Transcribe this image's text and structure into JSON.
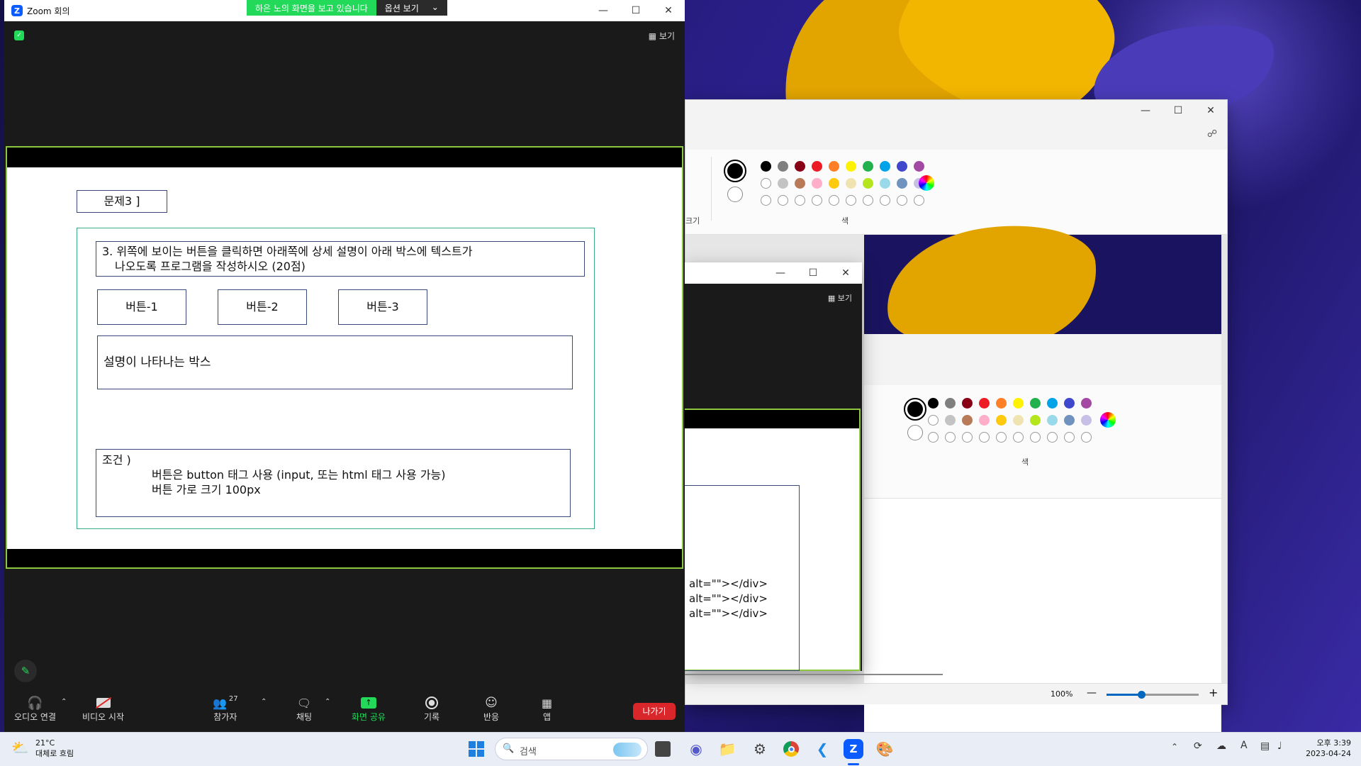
{
  "zoom": {
    "title": "Zoom 회의",
    "banner_text": "하은 노의 화면을 보고 있습니다",
    "options_label": "옵션 보기",
    "view_label": "보기",
    "leave_label": "나가기",
    "toolbar": {
      "audio": "오디오 연결",
      "video": "비디오 시작",
      "participants": "참가자",
      "participants_count": "27",
      "chat": "채팅",
      "share": "화면 공유",
      "record": "기록",
      "reactions": "반응",
      "apps": "앱"
    }
  },
  "slide": {
    "question_label": "문제3 ]",
    "question_line1": "3. 위쪽에 보이는 버튼을 클릭하면 아래쪽에 상세 설명이 아래 박스에 텍스트가",
    "question_line2": "나오도록 프로그램을 작성하시오 (20점)",
    "buttons": [
      "버튼-1",
      "버튼-2",
      "버튼-3"
    ],
    "desc_box": "설명이 나타나는 박스",
    "cond_title": "조건 )",
    "cond_line1": "버튼은 button 태그 사용 (input, 또는 html 태그 사용 가능)",
    "cond_line2": "버튼 가로 크기 100px"
  },
  "paint": {
    "color_section_label": "색",
    "size_label_fragment": "크기",
    "zoom_level": "100%",
    "colors_row1": [
      "#000000",
      "#7f7f7f",
      "#880015",
      "#ed1c24",
      "#ff7f27",
      "#fff200",
      "#22b14c",
      "#00a2e8",
      "#3f48cc",
      "#a349a4"
    ],
    "colors_row2": [
      "#ffffff",
      "#c3c3c3",
      "#b97a57",
      "#ffaec9",
      "#ffc90e",
      "#efe4b0",
      "#b5e61d",
      "#99d9ea",
      "#7092be",
      "#c8bfe7"
    ]
  },
  "mini_zoom": {
    "view_label": "보기",
    "code_lines": [
      "alt=\"\"></div>",
      "alt=\"\"></div>",
      "alt=\"\"></div>"
    ]
  },
  "taskbar": {
    "weather_temp": "21°C",
    "weather_desc": "대체로 흐림",
    "search_placeholder": "검색",
    "time": "오후 3:39",
    "date": "2023-04-24"
  }
}
